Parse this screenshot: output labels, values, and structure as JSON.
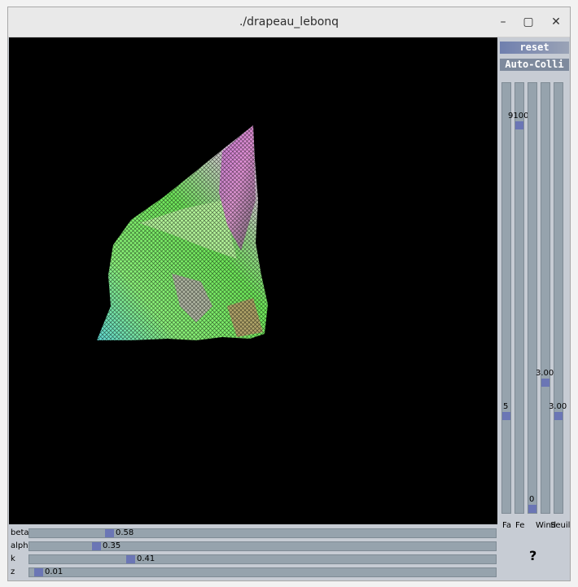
{
  "window": {
    "title": "./drapeau_lebonq",
    "minimize_glyph": "–",
    "maximize_glyph": "▢",
    "close_glyph": "✕"
  },
  "buttons": {
    "reset": "reset",
    "auto_colli": "Auto-Colli"
  },
  "vertical_sliders": [
    {
      "label": "Fa",
      "value": "5",
      "fraction": 0.22
    },
    {
      "label": "Fe",
      "value": "9100",
      "fraction": 0.91
    },
    {
      "label": "",
      "value": "0",
      "fraction": 0.0
    },
    {
      "label": "Wind",
      "value": "3.00",
      "fraction": 0.3
    },
    {
      "label": "Seuil",
      "value": "3.00",
      "fraction": 0.22
    }
  ],
  "help_label": "?",
  "horizontal_sliders": [
    {
      "label": "beta",
      "value": "0.58",
      "fraction": 0.165
    },
    {
      "label": "alpha",
      "value": "0.35",
      "fraction": 0.137
    },
    {
      "label": "k",
      "value": "0.41",
      "fraction": 0.212
    },
    {
      "label": "z",
      "value": "0.01",
      "fraction": 0.01
    }
  ],
  "colors": {
    "viewport_bg": "#000000",
    "panel_bg": "#c7ccd4",
    "slider_track": "#96a3ad",
    "slider_thumb": "#6b76b5"
  },
  "icons": [
    "minimize-icon",
    "maximize-icon",
    "close-icon",
    "help-icon"
  ]
}
